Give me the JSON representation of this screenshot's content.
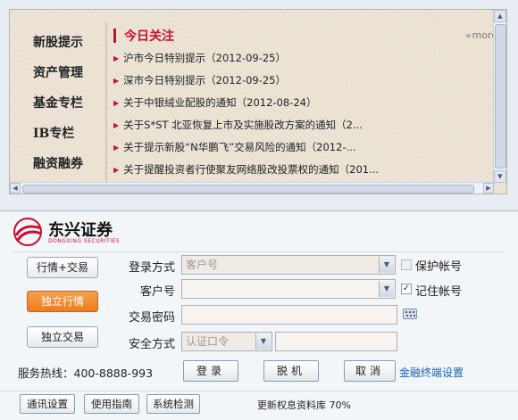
{
  "menu": {
    "items": [
      "新股提示",
      "资产管理",
      "基金专栏",
      "IB专栏",
      "融资融券"
    ]
  },
  "news": {
    "title": "今日关注",
    "more": "more",
    "items": [
      "沪市今日特别提示（2012-09-25）",
      "深市今日特别提示（2012-09-25）",
      "关于中银绒业配股的通知（2012-08-24）",
      "关于S*ST 北亚恢复上市及实施股改方案的通知（2...",
      "关于提示新股“N华鹏飞”交易风险的通知（2012-...",
      "关于提醒投资者行使聚友网络股改投票权的通知（201..."
    ]
  },
  "logo": {
    "name": "东兴证券",
    "subtitle": "DONGXING SECURITIES",
    "brand_color": "#c8102e"
  },
  "side_buttons": {
    "trade": "行情+交易",
    "market": "独立行情",
    "exchange": "独立交易"
  },
  "form": {
    "login_mode_label": "登录方式",
    "login_mode_value": "客户号",
    "account_label": "客户号",
    "account_value": "",
    "password_label": "交易密码",
    "security_label": "安全方式",
    "security_value": "认证口令",
    "protect_account_label": "保护帐号",
    "protect_account_checked": false,
    "remember_account_label": "记住帐号",
    "remember_account_checked": true
  },
  "footer": {
    "hotline": "服务热线：400-8888-993",
    "login_button": "登录",
    "offline_button": "脱机",
    "cancel_button": "取消",
    "terminal_link": "金融终端设置",
    "comm_settings": "通讯设置",
    "guide": "使用指南",
    "system_check": "系统检测",
    "status": "更新权息资料库 70%"
  },
  "icons": [
    "chevron-up-icon",
    "chevron-down-icon",
    "chevron-left-icon",
    "chevron-right-icon",
    "keyboard-icon",
    "dropdown-arrow-icon",
    "check-icon",
    "more-arrows-icon",
    "bullet-icon"
  ]
}
